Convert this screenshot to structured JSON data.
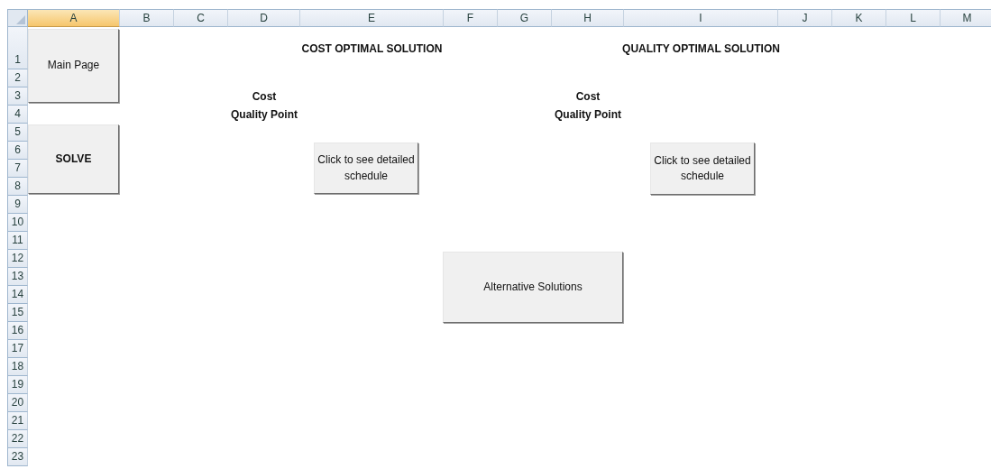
{
  "column_headers": [
    {
      "label": "A",
      "selected": true
    },
    {
      "label": "B",
      "selected": false
    },
    {
      "label": "C",
      "selected": false
    },
    {
      "label": "D",
      "selected": false
    },
    {
      "label": "E",
      "selected": false
    },
    {
      "label": "F",
      "selected": false
    },
    {
      "label": "G",
      "selected": false
    },
    {
      "label": "H",
      "selected": false
    },
    {
      "label": "I",
      "selected": false
    },
    {
      "label": "J",
      "selected": false
    },
    {
      "label": "K",
      "selected": false
    },
    {
      "label": "L",
      "selected": false
    },
    {
      "label": "M",
      "selected": false
    }
  ],
  "row_headers": [
    "1",
    "2",
    "3",
    "4",
    "5",
    "6",
    "7",
    "8",
    "9",
    "10",
    "11",
    "12",
    "13",
    "14",
    "15",
    "16",
    "17",
    "18",
    "19",
    "20",
    "21",
    "22",
    "23"
  ],
  "side_buttons": [
    {
      "label": "Main Page"
    },
    {
      "label": "SOLVE"
    }
  ],
  "solutions": [
    {
      "title": "COST OPTIMAL SOLUTION",
      "labels": [
        "Cost",
        "Quality Point"
      ],
      "button": "Click to see detailed schedule"
    },
    {
      "title": "QUALITY OPTIMAL SOLUTION",
      "labels": [
        "Cost",
        "Quality Point"
      ],
      "button": "Click to see detailed schedule"
    }
  ],
  "alternative_button": "Alternative Solutions"
}
